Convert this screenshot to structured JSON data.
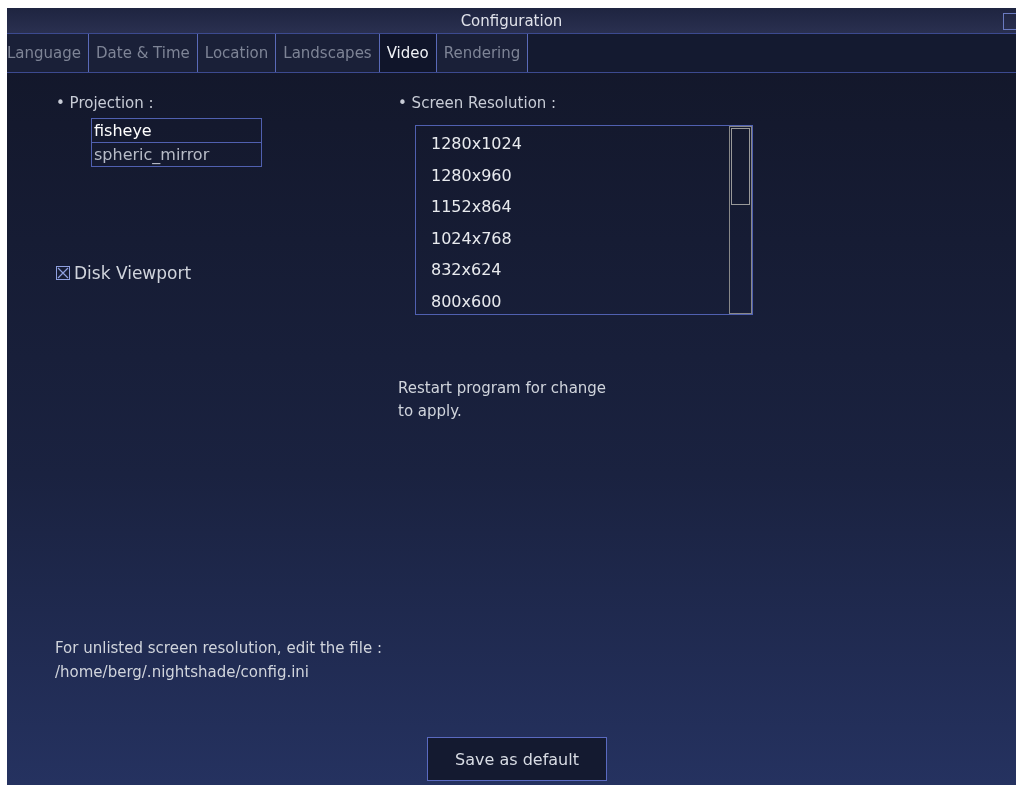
{
  "window": {
    "title": "Configuration"
  },
  "tabs": [
    {
      "label": "Language",
      "selected": false
    },
    {
      "label": "Date & Time",
      "selected": false
    },
    {
      "label": "Location",
      "selected": false
    },
    {
      "label": "Landscapes",
      "selected": false
    },
    {
      "label": "Video",
      "selected": true
    },
    {
      "label": "Rendering",
      "selected": false
    }
  ],
  "projection": {
    "label": "• Projection :",
    "items": [
      {
        "label": "fisheye",
        "selected": true
      },
      {
        "label": "spheric_mirror",
        "selected": false
      }
    ]
  },
  "disk_viewport": {
    "label": "Disk Viewport",
    "checked": true
  },
  "resolution": {
    "label": "• Screen Resolution :",
    "items": [
      "1280x1024",
      "1280x960",
      "1152x864",
      "1024x768",
      "832x624",
      "800x600"
    ]
  },
  "restart_note": "Restart program for change to apply.",
  "unlisted_note": [
    "For unlisted screen resolution, edit the file :",
    "/home/berg/.nightshade/config.ini"
  ],
  "save_button": "Save as default"
}
